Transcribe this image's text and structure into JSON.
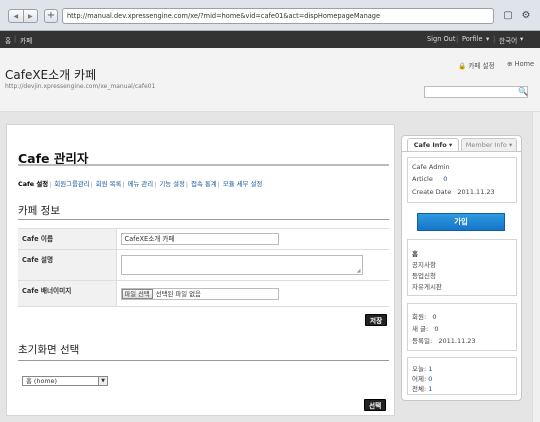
{
  "browser": {
    "url": "http://manual.dev.xpressengine.com/xe/?mid=home&vid=cafe01&act=dispHomepageManage",
    "back_glyph": "◀",
    "forward_glyph": "▶",
    "plus_glyph": "+",
    "page_glyph": "▢",
    "gear_glyph": "⚙"
  },
  "topbar": {
    "home": "홈",
    "cafe": "카페",
    "sign_out": "Sign Out",
    "profile": "Porfile",
    "language": "한국어"
  },
  "header": {
    "title": "CafeXE소개 카페",
    "url": "http://devjin.xpressengine.com/xe_manual/cafe01",
    "settings_link": "카페 설정",
    "home_link": "Home",
    "search_glyph": "🔍"
  },
  "main": {
    "title": "Cafe 관리자",
    "submenu": [
      "Cafe 설정",
      "회원그룹관리",
      "회원 목록",
      "메뉴 관리",
      "기능 설정",
      "접속 통계",
      "모듈 세부 설정"
    ],
    "section1_title": "카페 정보",
    "form": {
      "name_label": "Cafe 이름",
      "name_value": "CafeXE소개 카페",
      "desc_label": "Cafe 설명",
      "banner_label": "Cafe 배너이미지",
      "file_button": "파일 선택",
      "file_status": "선택된 파일 없음"
    },
    "save_button": "저장",
    "section2_title": "초기화면 선택",
    "select_value": "홈 (home)",
    "select_button": "선택"
  },
  "sidebar": {
    "tab_info": "Cafe Info",
    "tab_member": "Member Info",
    "admin": "Cafe Admin",
    "article_label": "Article",
    "article_value": "0",
    "created_label": "Create Date",
    "created_value": "2011.11.23",
    "join_button": "가입",
    "menu": [
      "홈",
      "공지사항",
      "등업신청",
      "자유게시판"
    ],
    "members_label": "회원:",
    "members_value": "0",
    "posts_label": "새 글:",
    "posts_value": "0",
    "registered_label": "등록일:",
    "registered_value": "2011.11.23",
    "today_label": "오늘:",
    "today_value": "1",
    "yesterday_label": "어제:",
    "yesterday_value": "0",
    "total_label": "전체:",
    "total_value": "1"
  },
  "colors": {
    "accent_blue": "#1a7fd1",
    "link": "#1b57a3",
    "topbar": "#333333"
  }
}
